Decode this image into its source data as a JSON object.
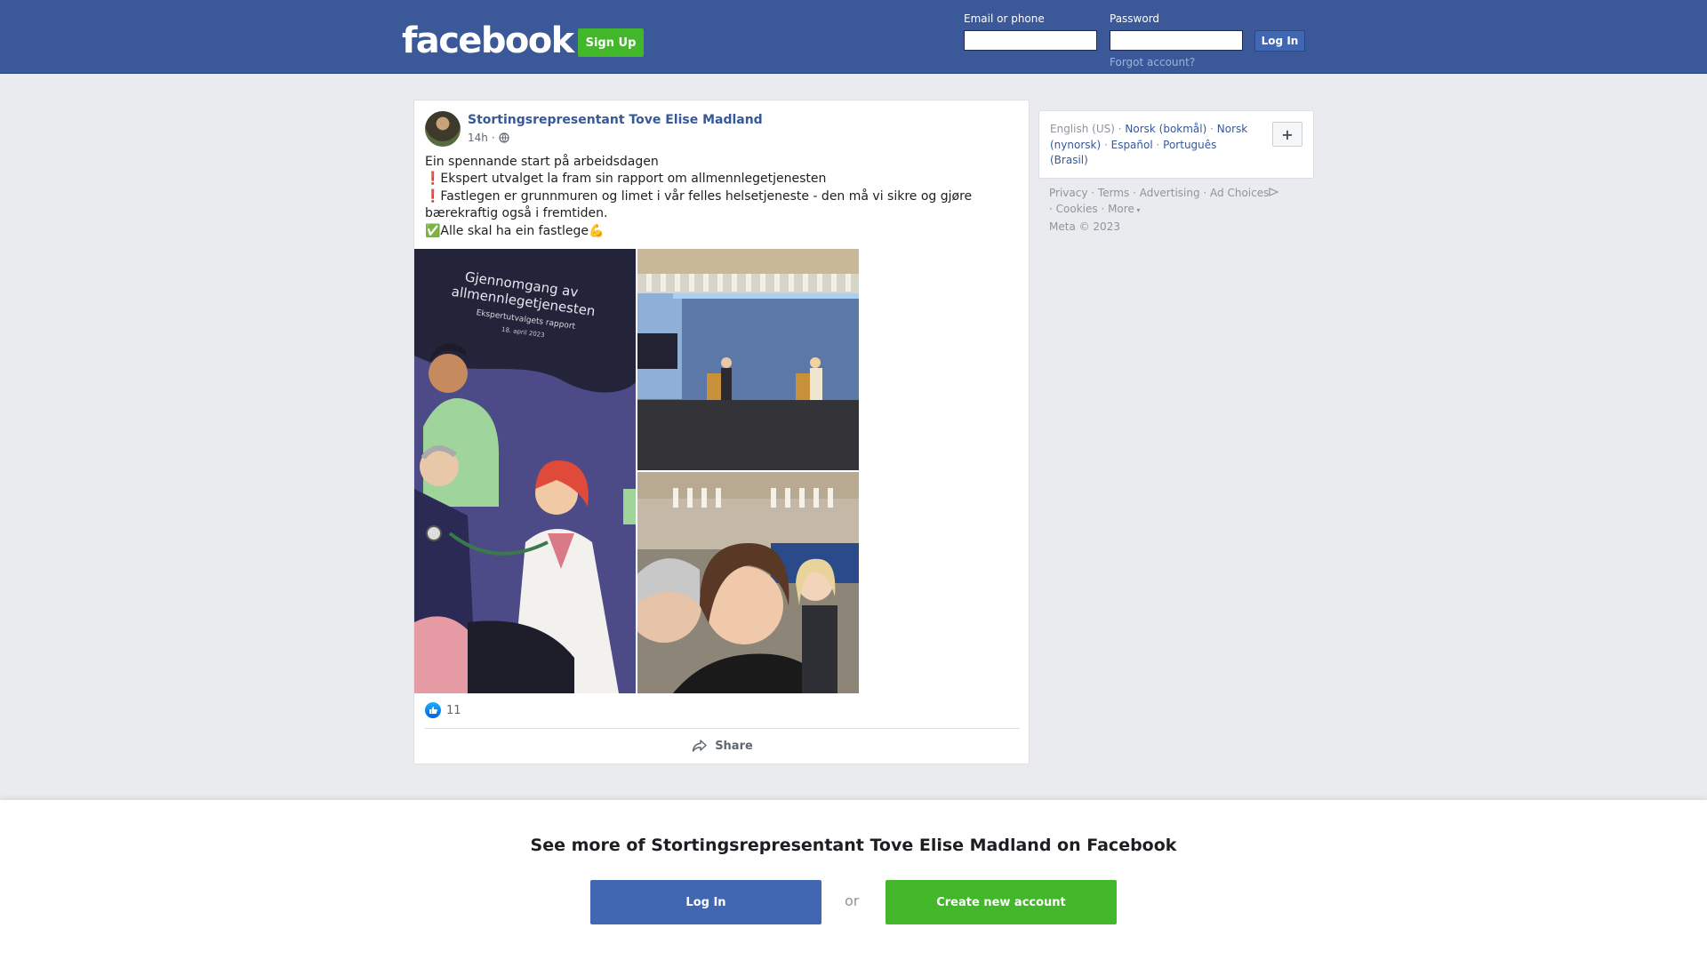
{
  "header": {
    "logo_text": "facebook",
    "signup_label": "Sign Up",
    "email_label": "Email or phone",
    "email_value": "",
    "password_label": "Password",
    "password_value": "",
    "login_label": "Log In",
    "forgot_label": "Forgot account?"
  },
  "post": {
    "author": "Stortingsrepresentant Tove Elise Madland",
    "time": "14h",
    "separator": "·",
    "lines": [
      "Ein spennande start på arbeidsdagen",
      "❗Ekspert utvalget la fram sin rapport om allmennlegetjenesten",
      "❗Fastlegen er grunnmuren og limet i vår felles helsetjeneste - den må vi sikre og gjøre bærekraftig også i fremtiden.",
      "✅Alle skal ha ein fastlege💪"
    ],
    "photo_1_caption": {
      "line1": "Gjennomgang av",
      "line2": "allmennlegetjenesten",
      "line3": "Ekspertutvalgets rapport",
      "line4": "18. april 2023"
    },
    "reaction_count": "11",
    "share_label": "Share"
  },
  "sidebar": {
    "languages": {
      "current": "English (US)",
      "links": [
        "Norsk (bokmål)",
        "Norsk (nynorsk)",
        "Español",
        "Português (Brasil)"
      ]
    },
    "plus_label": "+",
    "footer": {
      "privacy": "Privacy",
      "terms": "Terms",
      "advertising": "Advertising",
      "ad_choices": "Ad Choices",
      "cookies": "Cookies",
      "more": "More",
      "copyright": "Meta © 2023"
    }
  },
  "bottom_sheet": {
    "title": "See more of Stortingsrepresentant Tove Elise Madland on Facebook",
    "login_label": "Log In",
    "or_label": "or",
    "create_label": "Create new account"
  },
  "colors": {
    "brand_blue": "#3b5998",
    "link_blue": "#365899",
    "button_blue": "#4267b2",
    "signup_green": "#42b72a",
    "page_bg": "#e9ebee"
  }
}
